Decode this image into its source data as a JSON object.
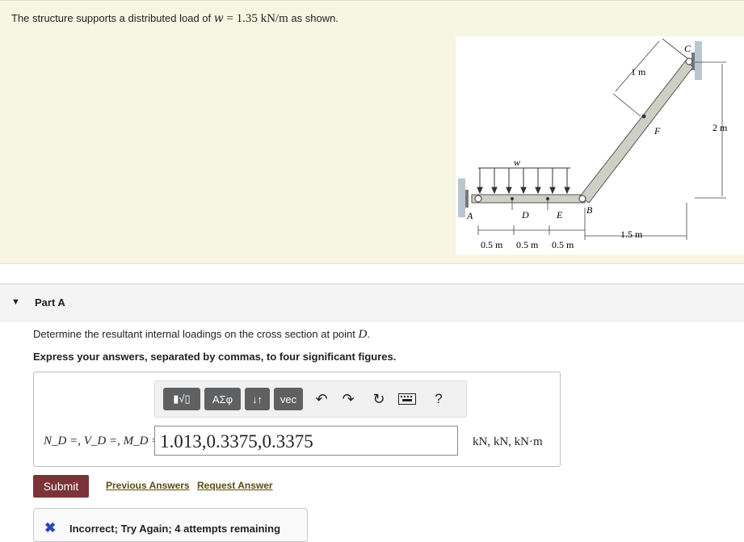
{
  "problem": {
    "intro": "The structure supports a distributed load of",
    "var": "w",
    "eq": "= 1.35 kN/m",
    "tail": "as shown."
  },
  "figure": {
    "labels": {
      "A": "A",
      "B": "B",
      "C": "C",
      "D": "D",
      "E": "E",
      "F": "F",
      "w": "w",
      "dim_1m": "1 m",
      "dim_2m": "2 m",
      "dim_15m": "1.5 m",
      "dim_05a": "0.5 m",
      "dim_05b": "0.5 m",
      "dim_05c": "0.5 m"
    }
  },
  "part": {
    "title": "Part A"
  },
  "question": {
    "line1_pre": "Determine the resultant internal loadings on the cross section at point",
    "line1_point": "D",
    "line1_post": ".",
    "line2": "Express your answers, separated by commas, to four significant figures."
  },
  "toolbar": {
    "templates_label": "▮√▯",
    "greek_label": "ΑΣφ",
    "updown_label": "↓↑",
    "vec_label": "vec",
    "help_label": "?"
  },
  "answer": {
    "label": "N_D =, V_D =, M_D =",
    "value": "1.013,0.3375,0.3375",
    "units": "kN, kN, kN·m"
  },
  "actions": {
    "submit": "Submit",
    "previous": "Previous Answers",
    "request": "Request Answer"
  },
  "feedback": {
    "message": "Incorrect; Try Again; 4 attempts remaining"
  },
  "colors": {
    "problem_bg": "#f6f6e3",
    "submit_bg": "#7b3238",
    "feedback_x": "#2b46b8",
    "toolbar_btn": "#5f6062"
  }
}
